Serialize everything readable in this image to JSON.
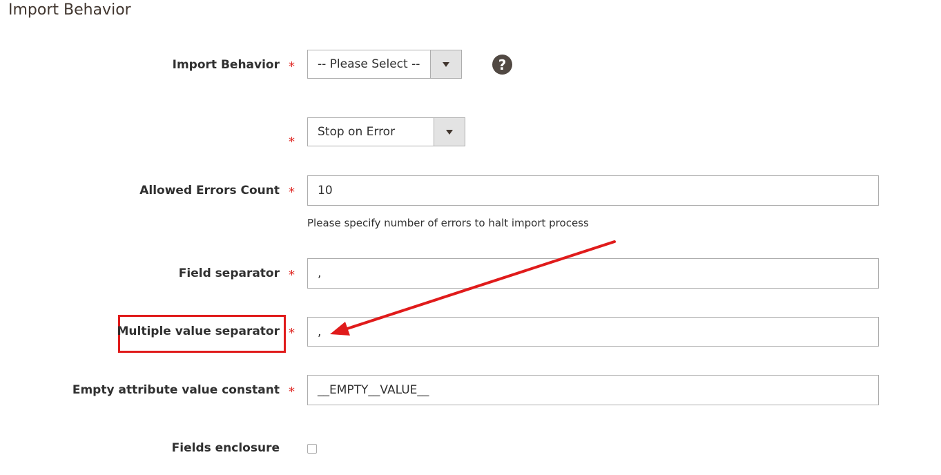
{
  "section": {
    "title": "Import Behavior"
  },
  "fields": {
    "import_behavior": {
      "label": "Import Behavior",
      "required": "*",
      "value": "-- Please Select --"
    },
    "error_mode": {
      "label": "",
      "required": "*",
      "value": "Stop on Error"
    },
    "allowed_errors": {
      "label": "Allowed Errors Count",
      "required": "*",
      "value": "10",
      "note": "Please specify number of errors to halt import process"
    },
    "field_separator": {
      "label": "Field separator",
      "required": "*",
      "value": ","
    },
    "multiple_value_separator": {
      "label": "Multiple value separator",
      "required": "*",
      "value": ","
    },
    "empty_attribute": {
      "label": "Empty attribute value constant",
      "required": "*",
      "value": "__EMPTY__VALUE__"
    },
    "fields_enclosure": {
      "label": "Fields enclosure",
      "checked": false
    }
  },
  "help_icon": {
    "glyph": "?"
  },
  "colors": {
    "required_star": "#e02b27",
    "annotation_red": "#e01b1b",
    "help_icon_bg": "#514943",
    "select_button_bg": "#e3e3e3"
  }
}
